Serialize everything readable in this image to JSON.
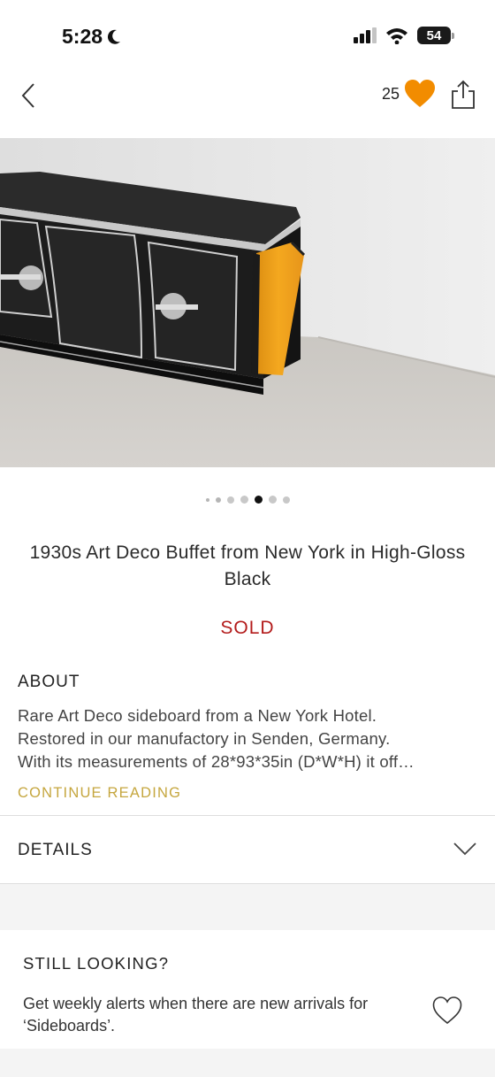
{
  "status_bar": {
    "time": "5:28",
    "battery": "54"
  },
  "nav": {
    "favorite_count": "25",
    "accent_color": "#f28c00"
  },
  "carousel": {
    "dot_count": 7,
    "active_index": 4
  },
  "product": {
    "title": "1930s Art Deco Buffet from New York in High-Gloss Black",
    "status": "SOLD",
    "status_color": "#b31b1b"
  },
  "about": {
    "heading": "ABOUT",
    "lines": [
      "Rare Art Deco sideboard from a New York Hotel.",
      "Restored in our manufactory in Senden, Germany.",
      "With its measurements of 28*93*35in (D*W*H) it off…"
    ],
    "continue_label": "CONTINUE READING"
  },
  "details": {
    "label": "DETAILS"
  },
  "still_looking": {
    "heading": "STILL LOOKING?",
    "text": "Get weekly alerts when there are new arrivals for ‘Sideboards’."
  }
}
